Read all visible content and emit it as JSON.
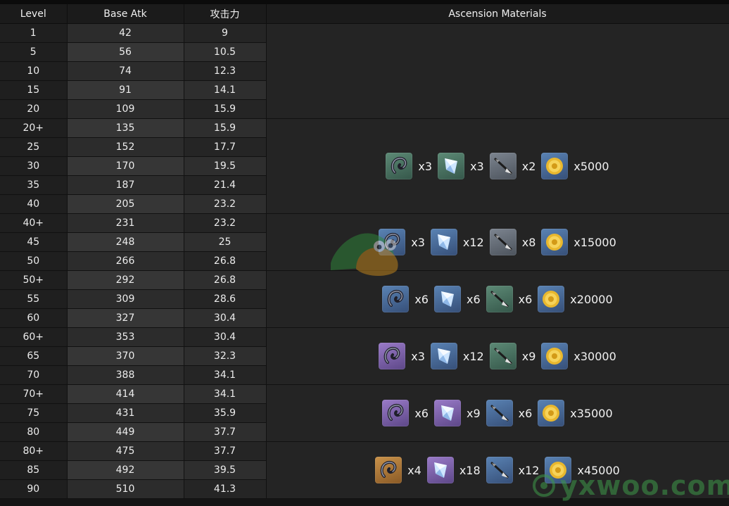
{
  "table": {
    "headers": {
      "level": "Level",
      "base_atk": "Base Atk",
      "secondary": "攻击力",
      "materials": "Ascension Materials"
    },
    "rows": [
      [
        "1",
        "42",
        "9"
      ],
      [
        "5",
        "56",
        "10.5"
      ],
      [
        "10",
        "74",
        "12.3"
      ],
      [
        "15",
        "91",
        "14.1"
      ],
      [
        "20",
        "109",
        "15.9"
      ],
      [
        "20+",
        "135",
        "15.9"
      ],
      [
        "25",
        "152",
        "17.7"
      ],
      [
        "30",
        "170",
        "19.5"
      ],
      [
        "35",
        "187",
        "21.4"
      ],
      [
        "40",
        "205",
        "23.2"
      ],
      [
        "40+",
        "231",
        "23.2"
      ],
      [
        "45",
        "248",
        "25"
      ],
      [
        "50",
        "266",
        "26.8"
      ],
      [
        "50+",
        "292",
        "26.8"
      ],
      [
        "55",
        "309",
        "28.6"
      ],
      [
        "60",
        "327",
        "30.4"
      ],
      [
        "60+",
        "353",
        "30.4"
      ],
      [
        "65",
        "370",
        "32.3"
      ],
      [
        "70",
        "388",
        "34.1"
      ],
      [
        "70+",
        "414",
        "34.1"
      ],
      [
        "75",
        "431",
        "35.9"
      ],
      [
        "80",
        "449",
        "37.7"
      ],
      [
        "80+",
        "475",
        "37.7"
      ],
      [
        "85",
        "492",
        "39.5"
      ],
      [
        "90",
        "510",
        "41.3"
      ]
    ]
  },
  "materials": [
    {
      "items": []
    },
    {
      "items": [
        {
          "icon": "horn-material-icon",
          "qty": "x3"
        },
        {
          "icon": "crystal-material-icon",
          "qty": "x3"
        },
        {
          "icon": "arrowhead-material-icon",
          "qty": "x2"
        },
        {
          "icon": "mora-coin-icon",
          "qty": "x5000"
        }
      ]
    },
    {
      "items": [
        {
          "icon": "horn-material-icon",
          "qty": "x3"
        },
        {
          "icon": "crystal-material-icon",
          "qty": "x12"
        },
        {
          "icon": "arrowhead-material-icon",
          "qty": "x8"
        },
        {
          "icon": "mora-coin-icon",
          "qty": "x15000"
        }
      ]
    },
    {
      "items": [
        {
          "icon": "horn-material-icon",
          "qty": "x6"
        },
        {
          "icon": "crystal-material-icon",
          "qty": "x6"
        },
        {
          "icon": "arrowhead-material-icon",
          "qty": "x6"
        },
        {
          "icon": "mora-coin-icon",
          "qty": "x20000"
        }
      ]
    },
    {
      "items": [
        {
          "icon": "horn-material-icon",
          "qty": "x3"
        },
        {
          "icon": "crystal-material-icon",
          "qty": "x12"
        },
        {
          "icon": "arrowhead-material-icon",
          "qty": "x9"
        },
        {
          "icon": "mora-coin-icon",
          "qty": "x30000"
        }
      ]
    },
    {
      "items": [
        {
          "icon": "horn-material-icon",
          "qty": "x6"
        },
        {
          "icon": "crystal-material-icon",
          "qty": "x9"
        },
        {
          "icon": "arrowhead-material-icon",
          "qty": "x6"
        },
        {
          "icon": "mora-coin-icon",
          "qty": "x35000"
        }
      ]
    },
    {
      "items": [
        {
          "icon": "horn-material-icon",
          "qty": "x4"
        },
        {
          "icon": "crystal-material-icon",
          "qty": "x18"
        },
        {
          "icon": "arrowhead-material-icon",
          "qty": "x12"
        },
        {
          "icon": "mora-coin-icon",
          "qty": "x45000"
        }
      ]
    }
  ],
  "watermark": {
    "text": "yxwoo.com"
  }
}
